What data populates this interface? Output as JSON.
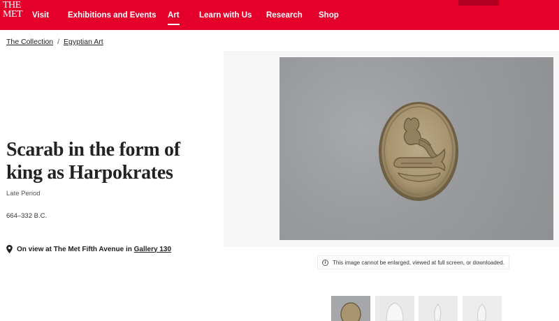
{
  "header": {
    "logo_lines": [
      "THE",
      "MET"
    ],
    "nav": [
      {
        "label": "Visit",
        "active": false
      },
      {
        "label": "Exhibitions and Events",
        "active": false
      },
      {
        "label": "Art",
        "active": true
      },
      {
        "label": "Learn with Us",
        "active": false
      },
      {
        "label": "Research",
        "active": false
      },
      {
        "label": "Shop",
        "active": false
      }
    ],
    "accent_color": "#e4002b"
  },
  "breadcrumb": {
    "items": [
      "The Collection",
      "Egyptian Art"
    ],
    "separator": "/"
  },
  "artwork": {
    "title_line1": "Scarab in the form of",
    "title_line2": "king as Harpokrates",
    "period": "Late Period",
    "date": "664–332 B.C.",
    "on_view_prefix": "On view at The Met Fifth Avenue in",
    "gallery_link": "Gallery 130"
  },
  "image": {
    "notice_icon": "info-icon",
    "notice": "This image cannot be enlarged, viewed at full screen, or downloaded."
  },
  "thumbnails": [
    "scarab-top-view",
    "scarab-side-view-1",
    "scarab-side-view-2",
    "scarab-side-view-3"
  ]
}
